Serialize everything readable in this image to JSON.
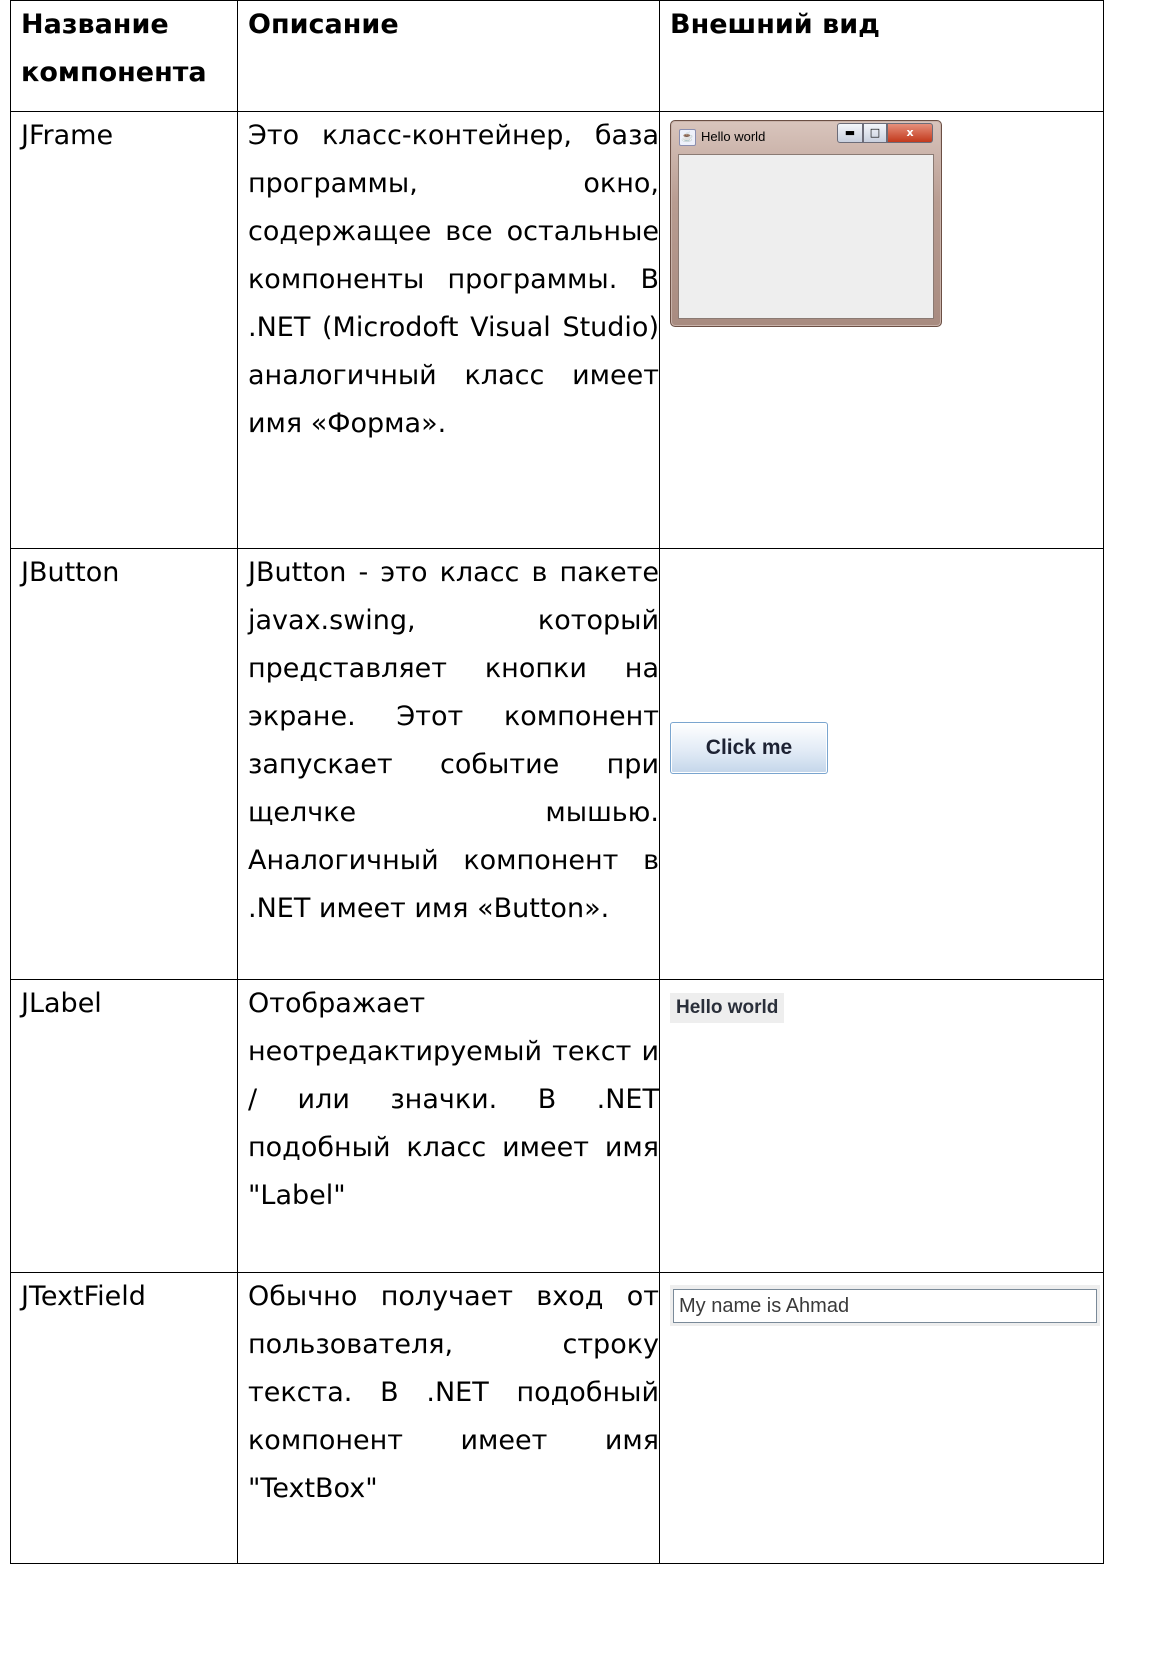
{
  "headers": {
    "name": "Название компонента",
    "desc": "Описание",
    "view": "Внешний вид"
  },
  "rows": [
    {
      "name": "JFrame",
      "desc": "Это класс-контейнер, база программы, окно, содержащее все остальные компоненты программы. В .NET (Microdoft Visual Studio) аналогичный класс имеет имя «Форма».",
      "preview": {
        "window_title": "Hello world",
        "close_glyph": "x",
        "app_icon": "java-cup-icon"
      }
    },
    {
      "name": "JButton",
      "desc": "JButton - это класс в пакете javax.swing, который представляет кнопки на экране. Этот компонент запускает событие при щелчке мышью. Аналогичный компонент в .NET имеет имя «Button».",
      "preview": {
        "button_label": "Click me"
      }
    },
    {
      "name": "JLabel",
      "desc": "Отображает неотредактируемый текст и / или значки. В .NET подобный класс имеет имя \"Label\"",
      "preview": {
        "label_text": "Hello world"
      }
    },
    {
      "name": "JTextField",
      "desc": "Обычно получает вход от пользователя, строку текста. В .NET подобный компонент имеет имя \"TextBox\"",
      "preview": {
        "field_value": "My name is Ahmad"
      }
    }
  ]
}
